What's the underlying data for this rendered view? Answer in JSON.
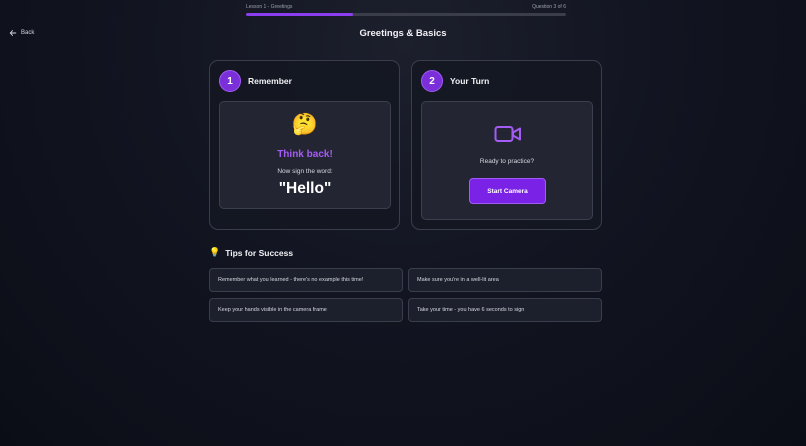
{
  "progress": {
    "lesson_label": "Lesson 1 - Greetings",
    "question_label": "Question 3 of 6",
    "fraction": 0.333
  },
  "nav": {
    "back_label": "Back"
  },
  "page": {
    "title": "Greetings & Basics"
  },
  "remember_card": {
    "step": "1",
    "title": "Remember",
    "emoji": "🤔",
    "headline": "Think back!",
    "instruction": "Now sign the word:",
    "word": "\"Hello\""
  },
  "turn_card": {
    "step": "2",
    "title": "Your Turn",
    "icon": "video-camera-icon",
    "prompt": "Ready to practice?",
    "button_label": "Start Camera"
  },
  "tips": {
    "icon": "💡",
    "title": "Tips for Success",
    "items": [
      "Remember what you learned - there's no example this time!",
      "Make sure you're in a well-lit area",
      "Keep your hands visible in the camera frame",
      "Take your time - you have 6 seconds to sign"
    ]
  },
  "colors": {
    "accent": "#7a22e6",
    "accent_text": "#a55cf5",
    "background": "#121521"
  }
}
